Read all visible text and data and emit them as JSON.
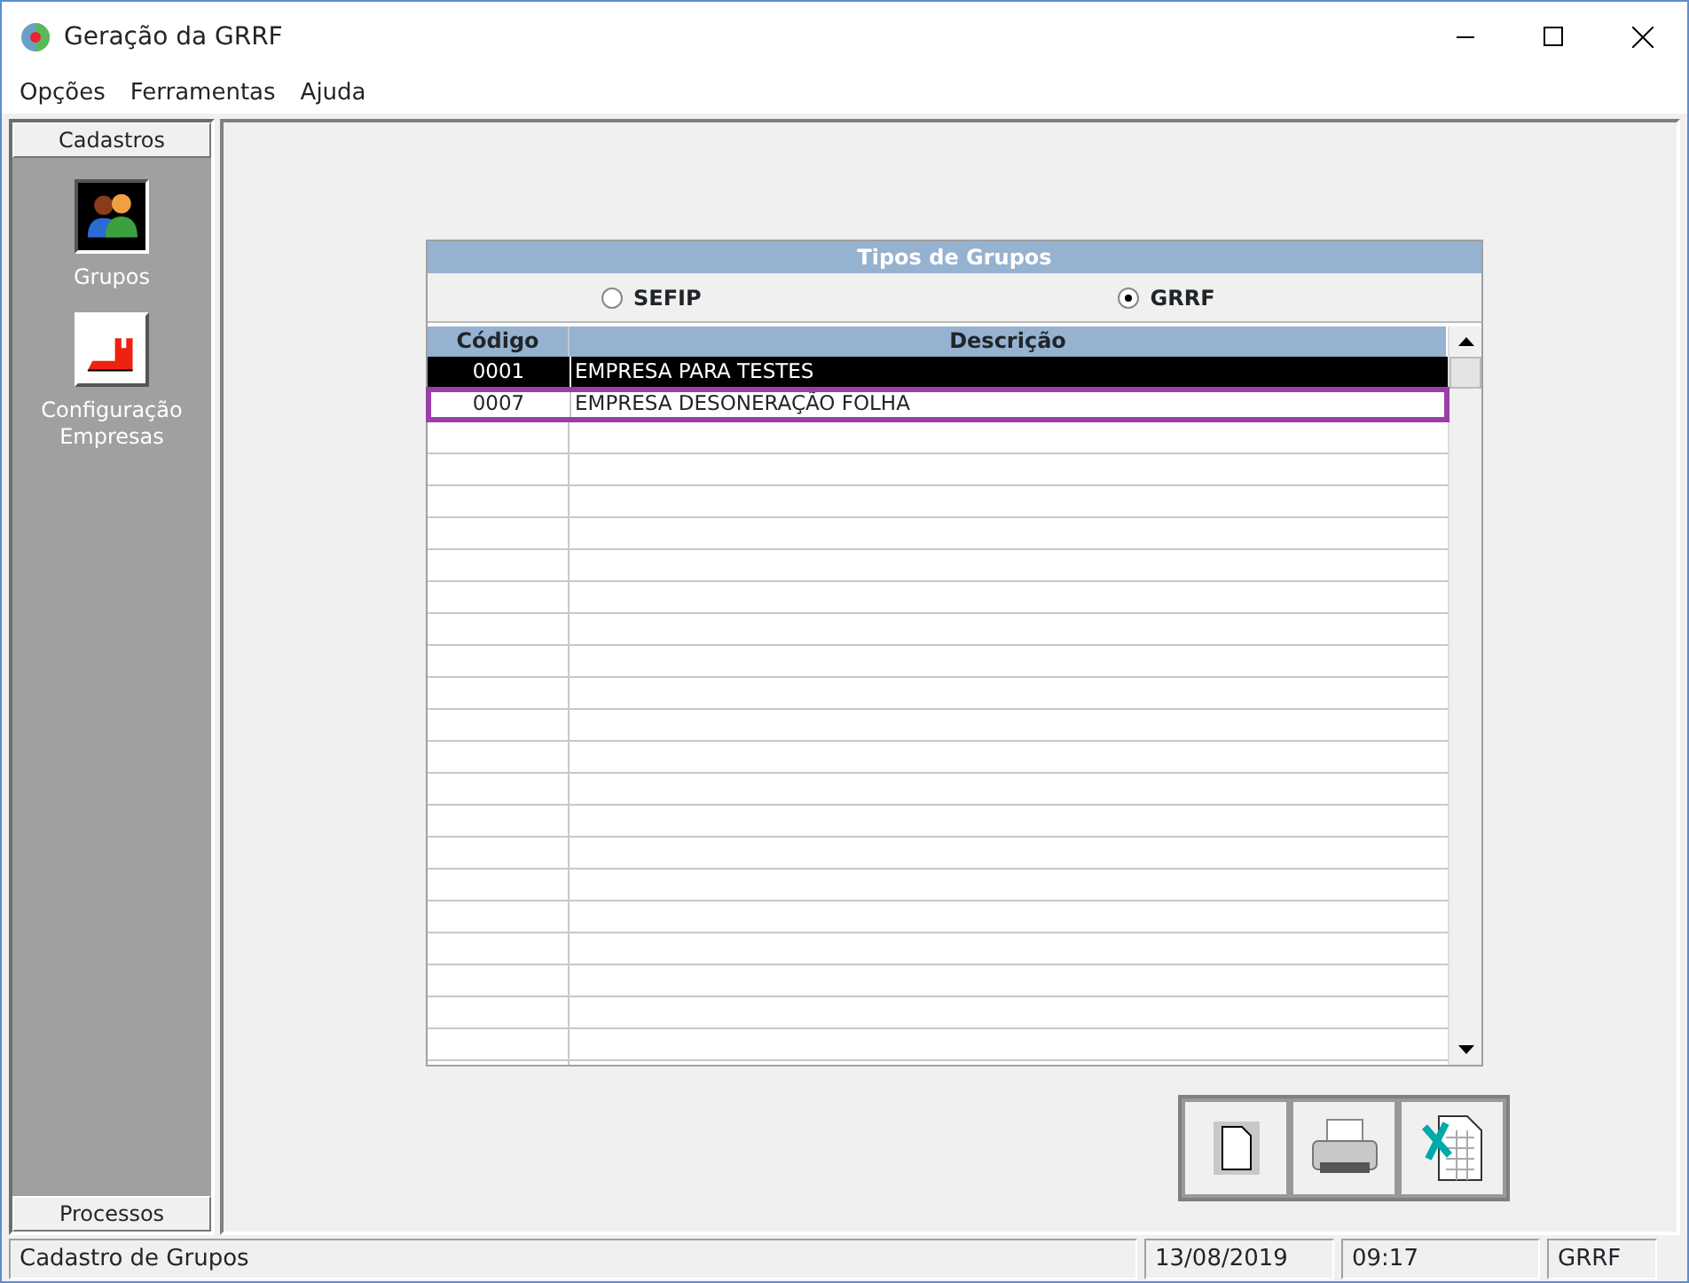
{
  "window": {
    "title": "Geração da GRRF"
  },
  "menu": [
    "Opções",
    "Ferramentas",
    "Ajuda"
  ],
  "sidebar": {
    "header": "Cadastros",
    "items": [
      {
        "kind": "groups",
        "label": "Grupos",
        "selected": true
      },
      {
        "kind": "company",
        "label": "Configuração Empresas",
        "selected": false
      }
    ],
    "footer": "Processos"
  },
  "panel": {
    "title": "Tipos de  Grupos",
    "options": [
      {
        "label": "SEFIP",
        "selected": false
      },
      {
        "label": "GRRF",
        "selected": true
      }
    ]
  },
  "table": {
    "columns": [
      "Código",
      "Descrição"
    ],
    "rows": [
      {
        "cells": [
          "0001",
          "EMPRESA PARA TESTES"
        ],
        "selected": true,
        "focused": false
      },
      {
        "cells": [
          "0007",
          "EMPRESA DESONERAÇÃO FOLHA"
        ],
        "selected": false,
        "focused": true
      }
    ]
  },
  "toolbar": [
    {
      "kind": "new"
    },
    {
      "kind": "print"
    },
    {
      "kind": "excel"
    }
  ],
  "status_bar": [
    "Cadastro de Grupos",
    "13/08/2019",
    "09:17",
    "GRRF"
  ]
}
